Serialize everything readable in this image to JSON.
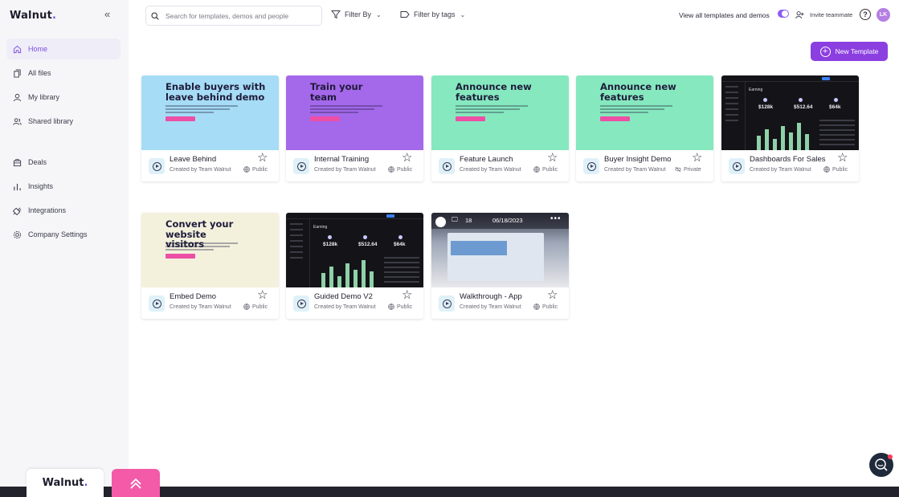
{
  "app": {
    "logo": "Walnut",
    "logo_dot": "."
  },
  "sidebar": {
    "collapse_icon": "double-chevron-left-icon",
    "items": [
      {
        "label": "Home",
        "icon": "home-icon",
        "active": true
      },
      {
        "label": "All files",
        "icon": "files-icon"
      },
      {
        "label": "My library",
        "icon": "user-icon"
      },
      {
        "label": "Shared library",
        "icon": "users-icon"
      },
      {
        "label": "Deals",
        "icon": "briefcase-icon"
      },
      {
        "label": "Insights",
        "icon": "bar-chart-icon"
      },
      {
        "label": "Integrations",
        "icon": "plug-icon"
      },
      {
        "label": "Company Settings",
        "icon": "gear-icon"
      }
    ]
  },
  "topbar": {
    "search_placeholder": "Search for templates, demos and people",
    "filter_by": "Filter By",
    "filter_tags": "Filter by tags",
    "view_all": "View all templates and demos",
    "invite": "Invite teammate",
    "help": "?",
    "avatar_initials": "LK"
  },
  "new_template": {
    "label": "New Template"
  },
  "cards": [
    {
      "title": "Leave Behind",
      "creator": "Created by Team Walnut",
      "visibility": "Public",
      "thumb_heading": "Enable buyers with leave behind demo",
      "thumb_color": "#a6dcf5"
    },
    {
      "title": "Internal Training",
      "creator": "Created by Team Walnut",
      "visibility": "Public",
      "thumb_heading": "Train your team",
      "thumb_color": "#a468ea"
    },
    {
      "title": "Feature Launch",
      "creator": "Created by Team Walnut",
      "visibility": "Public",
      "thumb_heading": "Announce new features",
      "thumb_color": "#86e8be"
    },
    {
      "title": "Buyer Insight Demo",
      "creator": "Created by Team Walnut",
      "visibility": "Private",
      "thumb_heading": "Announce new features",
      "thumb_color": "#86e8be"
    },
    {
      "title": "Dashboards For Sales",
      "creator": "Created by Team Walnut",
      "visibility": "Public",
      "dash": {
        "title": "Earning",
        "kpis": [
          "$128k",
          "$512.64",
          "$64k"
        ]
      }
    },
    {
      "title": "Embed Demo",
      "creator": "Created by Team Walnut",
      "visibility": "Public",
      "thumb_heading": "Convert your website visitors",
      "thumb_color": "#f3f1dc"
    },
    {
      "title": "Guided Demo V2",
      "creator": "Created by Team Walnut",
      "visibility": "Public",
      "dash": {
        "title": "Earning",
        "kpis": [
          "$128k",
          "$512.64",
          "$64k"
        ]
      }
    },
    {
      "title": "Walkthrough - App",
      "creator": "Created by Team Walnut",
      "visibility": "Public",
      "walk": {
        "count": "18",
        "date": "06/18/2023"
      }
    }
  ],
  "footer": {
    "logo": "Walnut",
    "logo_dot": "."
  },
  "colors": {
    "accent": "#8b3fe0",
    "sidebar_bg": "#f6f6f9",
    "pink": "#f35aa8"
  }
}
